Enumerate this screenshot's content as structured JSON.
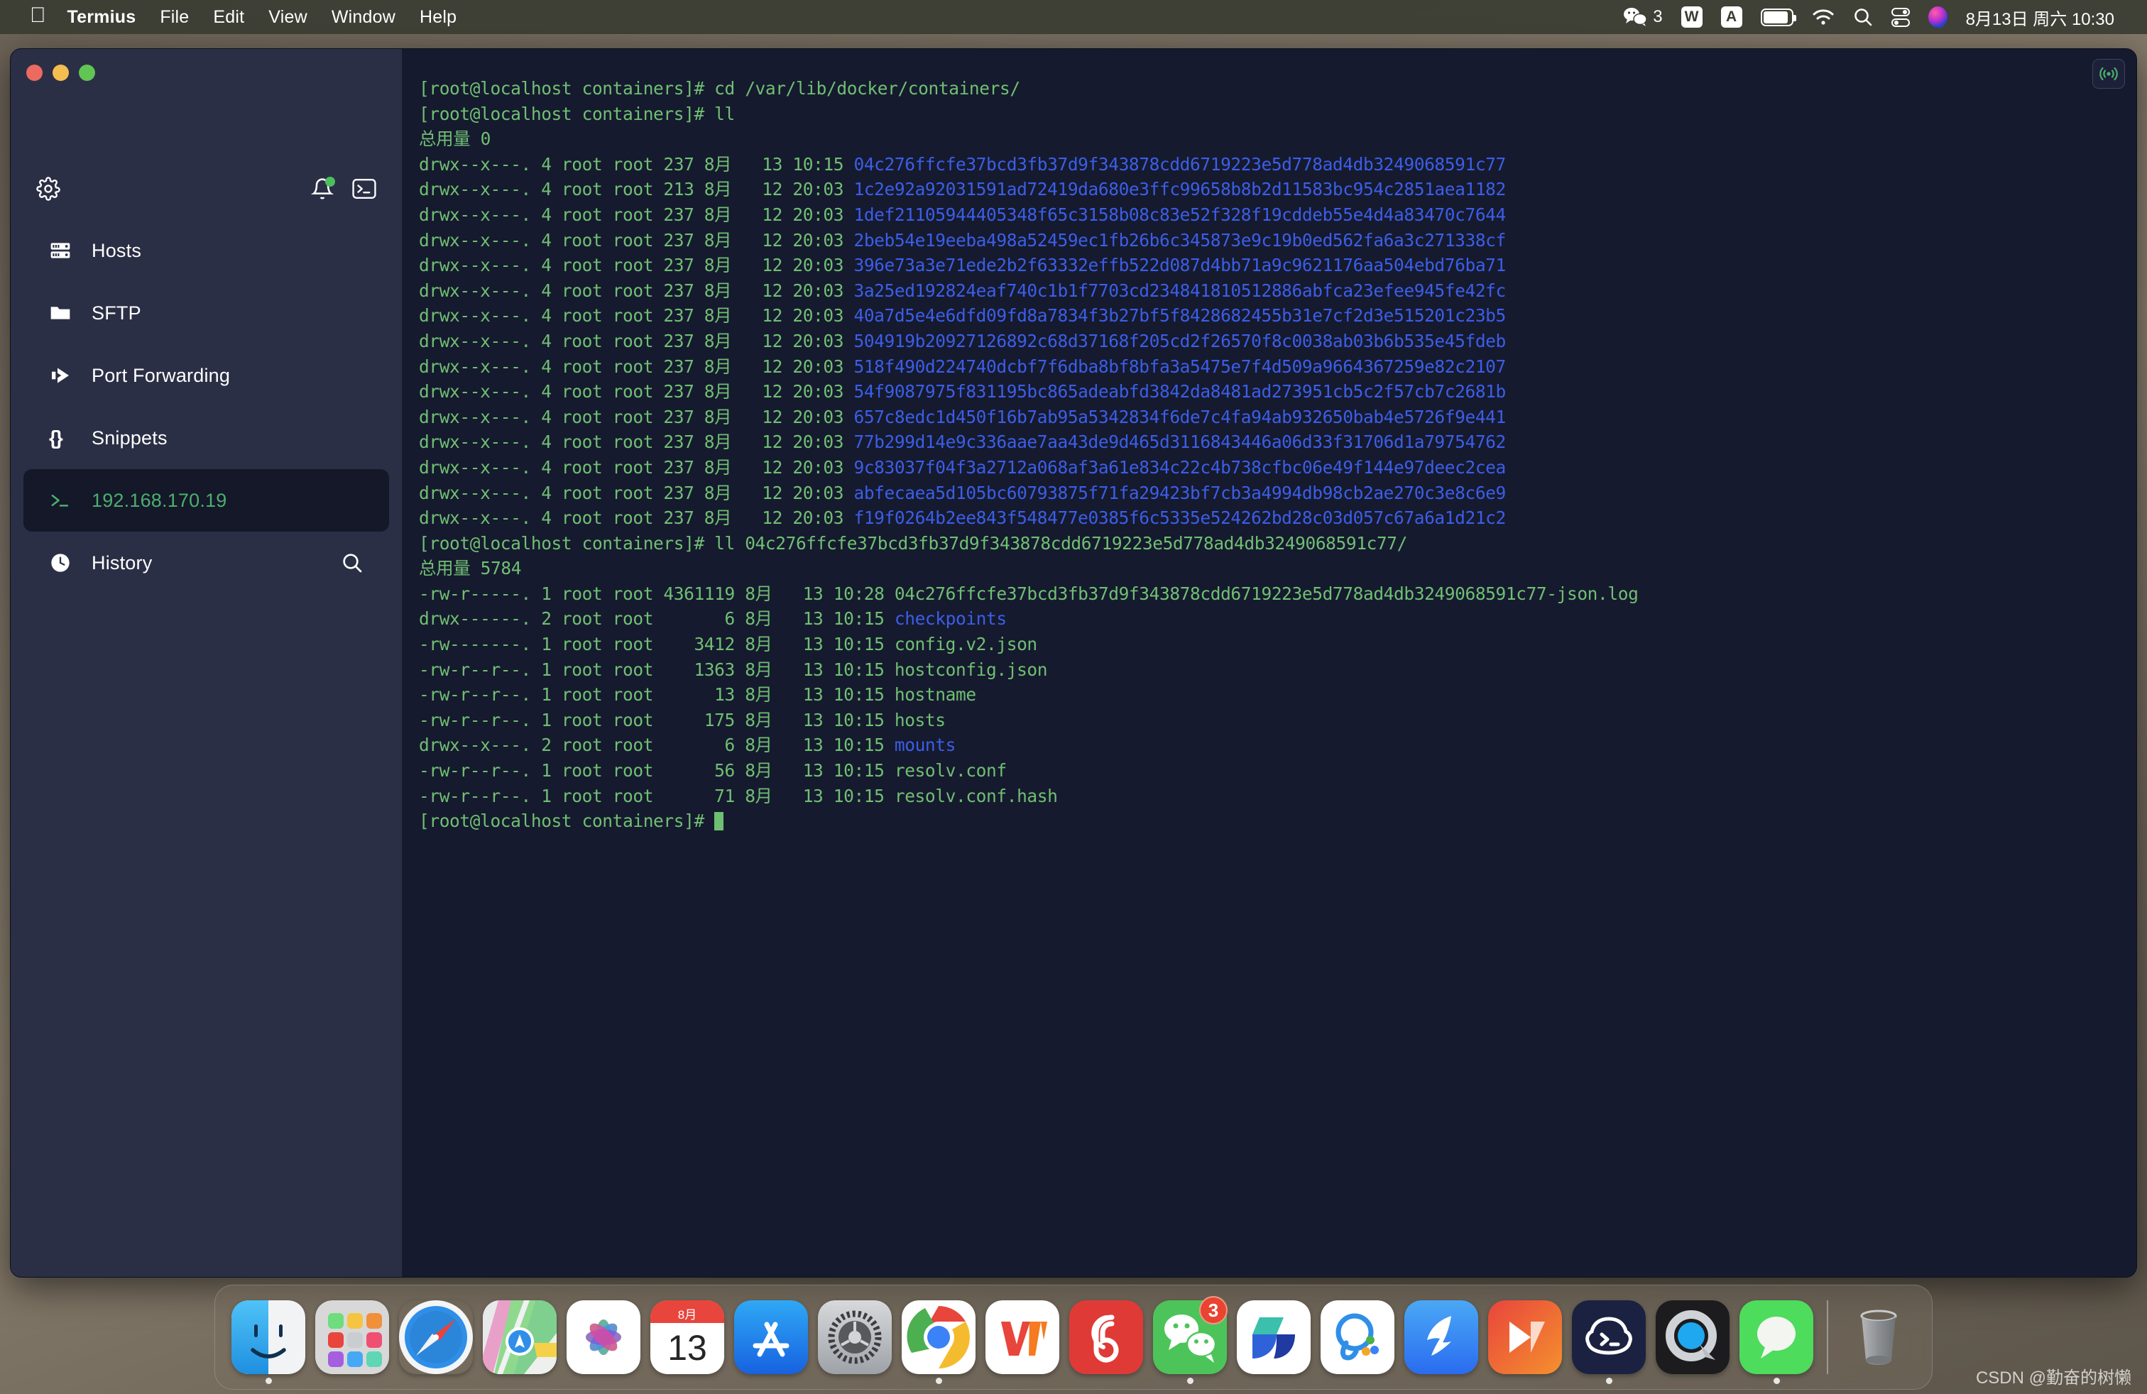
{
  "menubar": {
    "apple_glyph": "",
    "items": [
      {
        "label": "Termius",
        "bold": true
      },
      {
        "label": "File",
        "bold": false
      },
      {
        "label": "Edit",
        "bold": false
      },
      {
        "label": "View",
        "bold": false
      },
      {
        "label": "Window",
        "bold": false
      },
      {
        "label": "Help",
        "bold": false
      }
    ],
    "tray": {
      "wechat_badge": "3",
      "wps_glyph": "W",
      "input_glyph": "A",
      "clock": "8月13日 周六  10:30"
    }
  },
  "window": {
    "sidebar": {
      "toolbar": {
        "settings_icon": "gear-icon",
        "notifications_icon": "bell-icon",
        "new_terminal_icon": "terminal-icon"
      },
      "items": [
        {
          "label": "Hosts",
          "icon": "server-icon",
          "active": false
        },
        {
          "label": "SFTP",
          "icon": "folder-icon",
          "active": false
        },
        {
          "label": "Port Forwarding",
          "icon": "forward-arrow-icon",
          "active": false
        },
        {
          "label": "Snippets",
          "icon": "braces-icon",
          "active": false
        },
        {
          "label": "192.168.170.19",
          "icon": "terminal-prompt-icon",
          "active": true
        },
        {
          "label": "History",
          "icon": "clock-icon",
          "active": false,
          "right_icon": "search-icon"
        }
      ]
    },
    "terminal": {
      "broadcast_icon": "broadcast-icon",
      "lines": [
        {
          "segments": [
            {
              "t": "[root@localhost containers]# cd /var/lib/docker/containers/",
              "c": "green"
            }
          ]
        },
        {
          "segments": [
            {
              "t": "[root@localhost containers]# ll",
              "c": "green"
            }
          ]
        },
        {
          "segments": [
            {
              "t": "总用量 0",
              "c": "green"
            }
          ]
        },
        {
          "segments": [
            {
              "t": "drwx--x---. 4 root root 237 8月   13 10:15 ",
              "c": "green"
            },
            {
              "t": "04c276ffcfe37bcd3fb37d9f343878cdd6719223e5d778ad4db3249068591c77",
              "c": "blue"
            }
          ]
        },
        {
          "segments": [
            {
              "t": "drwx--x---. 4 root root 213 8月   12 20:03 ",
              "c": "green"
            },
            {
              "t": "1c2e92a92031591ad72419da680e3ffc99658b8b2d11583bc954c2851aea1182",
              "c": "blue"
            }
          ]
        },
        {
          "segments": [
            {
              "t": "drwx--x---. 4 root root 237 8月   12 20:03 ",
              "c": "green"
            },
            {
              "t": "1def21105944405348f65c3158b08c83e52f328f19cddeb55e4d4a83470c7644",
              "c": "blue"
            }
          ]
        },
        {
          "segments": [
            {
              "t": "drwx--x---. 4 root root 237 8月   12 20:03 ",
              "c": "green"
            },
            {
              "t": "2beb54e19eeba498a52459ec1fb26b6c345873e9c19b0ed562fa6a3c271338cf",
              "c": "blue"
            }
          ]
        },
        {
          "segments": [
            {
              "t": "drwx--x---. 4 root root 237 8月   12 20:03 ",
              "c": "green"
            },
            {
              "t": "396e73a3e71ede2b2f63332effb522d087d4bb71a9c9621176aa504ebd76ba71",
              "c": "blue"
            }
          ]
        },
        {
          "segments": [
            {
              "t": "drwx--x---. 4 root root 237 8月   12 20:03 ",
              "c": "green"
            },
            {
              "t": "3a25ed192824eaf740c1b1f7703cd234841810512886abfca23efee945fe42fc",
              "c": "blue"
            }
          ]
        },
        {
          "segments": [
            {
              "t": "drwx--x---. 4 root root 237 8月   12 20:03 ",
              "c": "green"
            },
            {
              "t": "40a7d5e4e6dfd09fd8a7834f3b27bf5f8428682455b31e7cf2d3e515201c23b5",
              "c": "blue"
            }
          ]
        },
        {
          "segments": [
            {
              "t": "drwx--x---. 4 root root 237 8月   12 20:03 ",
              "c": "green"
            },
            {
              "t": "504919b20927126892c68d37168f205cd2f26570f8c0038ab03b6b535e45fdeb",
              "c": "blue"
            }
          ]
        },
        {
          "segments": [
            {
              "t": "drwx--x---. 4 root root 237 8月   12 20:03 ",
              "c": "green"
            },
            {
              "t": "518f490d224740dcbf7f6dba8bf8bfa3a5475e7f4d509a9664367259e82c2107",
              "c": "blue"
            }
          ]
        },
        {
          "segments": [
            {
              "t": "drwx--x---. 4 root root 237 8月   12 20:03 ",
              "c": "green"
            },
            {
              "t": "54f9087975f831195bc865adeabfd3842da8481ad273951cb5c2f57cb7c2681b",
              "c": "blue"
            }
          ]
        },
        {
          "segments": [
            {
              "t": "drwx--x---. 4 root root 237 8月   12 20:03 ",
              "c": "green"
            },
            {
              "t": "657c8edc1d450f16b7ab95a5342834f6de7c4fa94ab932650bab4e5726f9e441",
              "c": "blue"
            }
          ]
        },
        {
          "segments": [
            {
              "t": "drwx--x---. 4 root root 237 8月   12 20:03 ",
              "c": "green"
            },
            {
              "t": "77b299d14e9c336aae7aa43de9d465d3116843446a06d33f31706d1a79754762",
              "c": "blue"
            }
          ]
        },
        {
          "segments": [
            {
              "t": "drwx--x---. 4 root root 237 8月   12 20:03 ",
              "c": "green"
            },
            {
              "t": "9c83037f04f3a2712a068af3a61e834c22c4b738cfbc06e49f144e97deec2cea",
              "c": "blue"
            }
          ]
        },
        {
          "segments": [
            {
              "t": "drwx--x---. 4 root root 237 8月   12 20:03 ",
              "c": "green"
            },
            {
              "t": "abfecaea5d105bc60793875f71fa29423bf7cb3a4994db98cb2ae270c3e8c6e9",
              "c": "blue"
            }
          ]
        },
        {
          "segments": [
            {
              "t": "drwx--x---. 4 root root 237 8月   12 20:03 ",
              "c": "green"
            },
            {
              "t": "f19f0264b2ee843f548477e0385f6c5335e524262bd28c03d057c67a6a1d21c2",
              "c": "blue"
            }
          ]
        },
        {
          "segments": [
            {
              "t": "[root@localhost containers]# ll 04c276ffcfe37bcd3fb37d9f343878cdd6719223e5d778ad4db3249068591c77/",
              "c": "green"
            }
          ]
        },
        {
          "segments": [
            {
              "t": "总用量 5784",
              "c": "green"
            }
          ]
        },
        {
          "segments": [
            {
              "t": "-rw-r-----. 1 root root 4361119 8月   13 10:28 04c276ffcfe37bcd3fb37d9f343878cdd6719223e5d778ad4db3249068591c77-json.log",
              "c": "green"
            }
          ]
        },
        {
          "segments": [
            {
              "t": "drwx------. 2 root root       6 8月   13 10:15 ",
              "c": "green"
            },
            {
              "t": "checkpoints",
              "c": "blue"
            }
          ]
        },
        {
          "segments": [
            {
              "t": "-rw-------. 1 root root    3412 8月   13 10:15 config.v2.json",
              "c": "green"
            }
          ]
        },
        {
          "segments": [
            {
              "t": "-rw-r--r--. 1 root root    1363 8月   13 10:15 hostconfig.json",
              "c": "green"
            }
          ]
        },
        {
          "segments": [
            {
              "t": "-rw-r--r--. 1 root root      13 8月   13 10:15 hostname",
              "c": "green"
            }
          ]
        },
        {
          "segments": [
            {
              "t": "-rw-r--r--. 1 root root     175 8月   13 10:15 hosts",
              "c": "green"
            }
          ]
        },
        {
          "segments": [
            {
              "t": "drwx--x---. 2 root root       6 8月   13 10:15 ",
              "c": "green"
            },
            {
              "t": "mounts",
              "c": "blue"
            }
          ]
        },
        {
          "segments": [
            {
              "t": "-rw-r--r--. 1 root root      56 8月   13 10:15 resolv.conf",
              "c": "green"
            }
          ]
        },
        {
          "segments": [
            {
              "t": "-rw-r--r--. 1 root root      71 8月   13 10:15 resolv.conf.hash",
              "c": "green"
            }
          ]
        },
        {
          "segments": [
            {
              "t": "[root@localhost containers]# ",
              "c": "green"
            },
            {
              "t": "",
              "c": "cursor"
            }
          ]
        }
      ]
    }
  },
  "dock": {
    "items": [
      {
        "name": "finder",
        "label": "Finder",
        "running": true
      },
      {
        "name": "launchpad",
        "label": "Launchpad",
        "running": false
      },
      {
        "name": "safari",
        "label": "Safari",
        "running": false
      },
      {
        "name": "maps",
        "label": "Maps",
        "running": false
      },
      {
        "name": "photos",
        "label": "Photos",
        "running": false
      },
      {
        "name": "calendar",
        "label": "Calendar",
        "running": false,
        "cal_month": "8月",
        "cal_day": "13"
      },
      {
        "name": "app-store",
        "label": "App Store",
        "running": false
      },
      {
        "name": "system-preferences",
        "label": "System Preferences",
        "running": false
      },
      {
        "name": "chrome",
        "label": "Google Chrome",
        "running": true
      },
      {
        "name": "wps-office",
        "label": "WPS Office",
        "running": false
      },
      {
        "name": "netease-music",
        "label": "NetEase Music",
        "running": false
      },
      {
        "name": "wechat",
        "label": "WeChat",
        "running": true,
        "badge": "3"
      },
      {
        "name": "yuque",
        "label": "Yuque",
        "running": false
      },
      {
        "name": "qq",
        "label": "QQ",
        "running": false
      },
      {
        "name": "dingtalk",
        "label": "DingTalk",
        "running": false
      },
      {
        "name": "xmind",
        "label": "Xmind",
        "running": false
      },
      {
        "name": "termius",
        "label": "Termius",
        "running": true
      },
      {
        "name": "quicktime",
        "label": "QuickTime Player",
        "running": false
      },
      {
        "name": "messages",
        "label": "Messages",
        "running": true
      }
    ],
    "trash": {
      "label": "Trash"
    }
  },
  "watermark": {
    "text": "CSDN @勤奋的树懒"
  }
}
